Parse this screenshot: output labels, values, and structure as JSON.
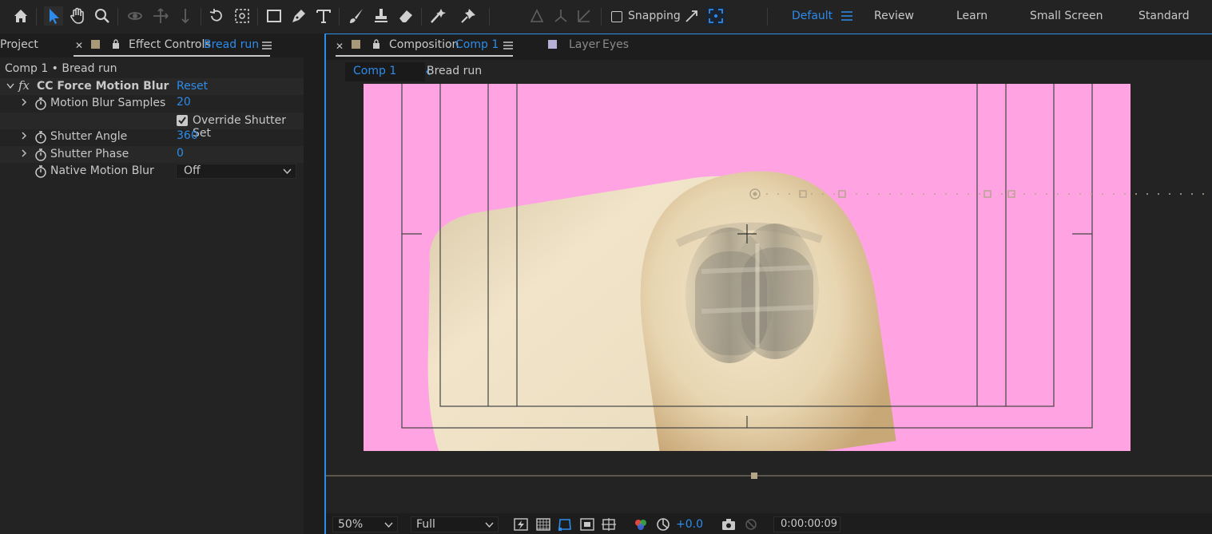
{
  "colors": {
    "accent": "#2d8ceb",
    "comp_background": "#ffa3e3",
    "layer_label_swatch": "#a89a78",
    "layer_eyes_swatch": "#b8b0d8"
  },
  "toolbar": {
    "tools": [
      "home-icon",
      "selection-icon",
      "hand-icon",
      "zoom-icon",
      "orbit-camera-icon",
      "pan-camera-icon",
      "dolly-camera-icon",
      "rotation-icon",
      "pan-behind-icon",
      "rectangle-icon",
      "pen-icon",
      "type-icon",
      "brush-icon",
      "clone-stamp-icon",
      "eraser-icon",
      "roto-brush-icon",
      "puppet-pin-icon"
    ],
    "snapping_label": "Snapping",
    "workspaces": {
      "active": "Default",
      "others": [
        "Review",
        "Learn",
        "Small Screen",
        "Standard"
      ]
    }
  },
  "left_panel": {
    "project_tab": "Project",
    "effect_controls_tab": "Effect Controls",
    "effect_controls_layer": "Bread run",
    "breadcrumb": "Comp 1 • Bread run",
    "effect": {
      "fx": "fx",
      "name": "CC Force Motion Blur",
      "reset": "Reset"
    },
    "properties": [
      {
        "label": "Motion Blur Samples",
        "value": "20"
      },
      {
        "label": "Override Shutter Set",
        "checked": true
      },
      {
        "label": "Shutter Angle",
        "value": "360"
      },
      {
        "label": "Shutter Phase",
        "value": "0"
      },
      {
        "label": "Native Motion Blur",
        "value": "Off"
      }
    ]
  },
  "comp_panel": {
    "composition_tab": "Composition",
    "composition_name": "Comp 1",
    "layer_tab": "Layer",
    "layer_name": "Eyes",
    "breadcrumbs": [
      "Comp 1",
      "Bread run"
    ]
  },
  "bottom_bar": {
    "zoom": "50%",
    "resolution": "Full",
    "exposure": "+0.0",
    "timecode": "0:00:00:09"
  }
}
